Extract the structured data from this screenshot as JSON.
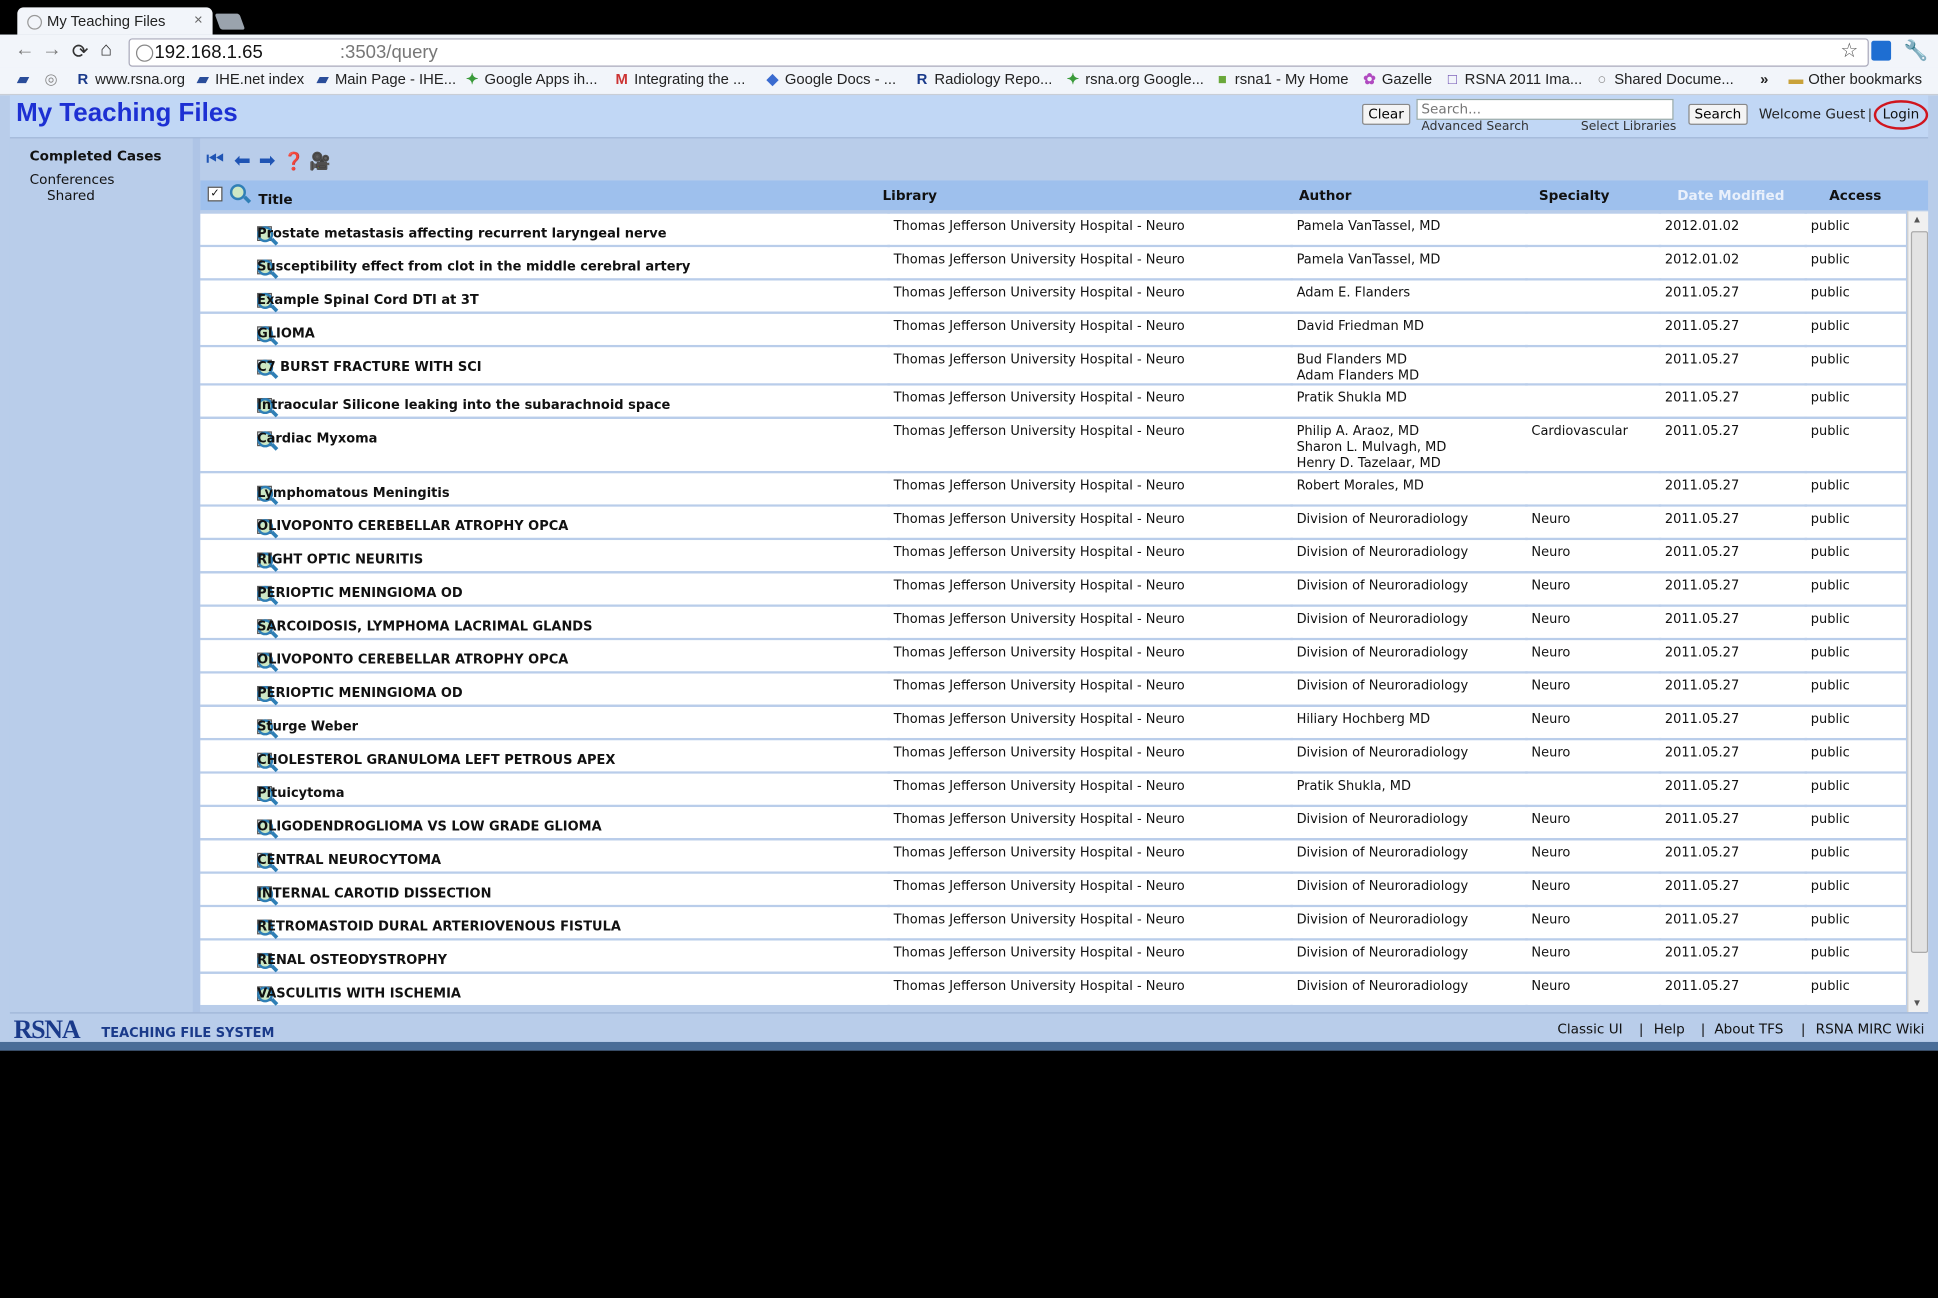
{
  "browser": {
    "tab_title": "My Teaching Files",
    "tab_close": "×",
    "url_host": "192.168.1.65",
    "url_path": ":3503/query",
    "bookmarks": [
      {
        "label": "www.rsna.org",
        "icon": "R"
      },
      {
        "label": "IHE.net index",
        "icon": "▰"
      },
      {
        "label": "Main Page - IHE...",
        "icon": "▰"
      },
      {
        "label": "Google Apps ih...",
        "icon": "✦"
      },
      {
        "label": "Integrating the ...",
        "icon": "M"
      },
      {
        "label": "Google Docs - ...",
        "icon": "◆"
      },
      {
        "label": "Radiology Repo...",
        "icon": "R"
      },
      {
        "label": "rsna.org Google...",
        "icon": "✦"
      },
      {
        "label": "rsna1 - My Home",
        "icon": "■"
      },
      {
        "label": "Gazelle",
        "icon": "✿"
      },
      {
        "label": "RSNA 2011 Ima...",
        "icon": "□"
      },
      {
        "label": "Shared Docume...",
        "icon": "○"
      }
    ],
    "more_bookmarks": "»",
    "other_bookmarks": "Other bookmarks"
  },
  "app": {
    "title": "My Teaching Files",
    "clear_label": "Clear",
    "search_placeholder": "Search...",
    "advanced_search": "Advanced Search",
    "select_libraries": "Select Libraries",
    "search_label": "Search",
    "welcome": "Welcome Guest",
    "separator": "|",
    "login_label": "Login"
  },
  "leftnav": {
    "heading": "Completed Cases",
    "conferences": "Conferences",
    "shared": "Shared"
  },
  "table": {
    "columns": [
      "Title",
      "Library",
      "Author",
      "Specialty",
      "Date Modified",
      "Access"
    ],
    "rows": [
      {
        "title": "Prostate metastasis affecting recurrent laryngeal nerve",
        "library": "Thomas Jefferson University Hospital - Neuro",
        "author": "Pamela VanTassel, MD",
        "specialty": "",
        "date": "2012.01.02",
        "access": "public"
      },
      {
        "title": "Susceptibility effect from clot in the middle cerebral artery",
        "library": "Thomas Jefferson University Hospital - Neuro",
        "author": "Pamela VanTassel, MD",
        "specialty": "",
        "date": "2012.01.02",
        "access": "public"
      },
      {
        "title": "Example Spinal Cord DTI at 3T",
        "library": "Thomas Jefferson University Hospital - Neuro",
        "author": "Adam E. Flanders",
        "specialty": "",
        "date": "2011.05.27",
        "access": "public"
      },
      {
        "title": "GLIOMA",
        "library": "Thomas Jefferson University Hospital - Neuro",
        "author": "David Friedman MD",
        "specialty": "",
        "date": "2011.05.27",
        "access": "public"
      },
      {
        "title": "C7 BURST FRACTURE WITH SCI",
        "library": "Thomas Jefferson University Hospital - Neuro",
        "author": "Bud Flanders MD\nAdam Flanders MD",
        "specialty": "",
        "date": "2011.05.27",
        "access": "public"
      },
      {
        "title": "Intraocular Silicone leaking into the subarachnoid space",
        "library": "Thomas Jefferson University Hospital - Neuro",
        "author": "Pratik Shukla MD",
        "specialty": "",
        "date": "2011.05.27",
        "access": "public"
      },
      {
        "title": "Cardiac Myxoma",
        "library": "Thomas Jefferson University Hospital - Neuro",
        "author": "Philip A. Araoz, MD\nSharon L. Mulvagh, MD\nHenry D. Tazelaar, MD",
        "specialty": "Cardiovascular",
        "date": "2011.05.27",
        "access": "public"
      },
      {
        "title": "Lymphomatous Meningitis",
        "library": "Thomas Jefferson University Hospital - Neuro",
        "author": "Robert Morales, MD",
        "specialty": "",
        "date": "2011.05.27",
        "access": "public"
      },
      {
        "title": "OLIVOPONTO CEREBELLAR ATROPHY OPCA",
        "library": "Thomas Jefferson University Hospital - Neuro",
        "author": "Division of Neuroradiology",
        "specialty": "Neuro",
        "date": "2011.05.27",
        "access": "public"
      },
      {
        "title": "RIGHT OPTIC NEURITIS",
        "library": "Thomas Jefferson University Hospital - Neuro",
        "author": "Division of Neuroradiology",
        "specialty": "Neuro",
        "date": "2011.05.27",
        "access": "public"
      },
      {
        "title": "PERIOPTIC MENINGIOMA OD",
        "library": "Thomas Jefferson University Hospital - Neuro",
        "author": "Division of Neuroradiology",
        "specialty": "Neuro",
        "date": "2011.05.27",
        "access": "public"
      },
      {
        "title": "SARCOIDOSIS, LYMPHOMA LACRIMAL GLANDS",
        "library": "Thomas Jefferson University Hospital - Neuro",
        "author": "Division of Neuroradiology",
        "specialty": "Neuro",
        "date": "2011.05.27",
        "access": "public"
      },
      {
        "title": "OLIVOPONTO CEREBELLAR ATROPHY OPCA",
        "library": "Thomas Jefferson University Hospital - Neuro",
        "author": "Division of Neuroradiology",
        "specialty": "Neuro",
        "date": "2011.05.27",
        "access": "public"
      },
      {
        "title": "PERIOPTIC MENINGIOMA OD",
        "library": "Thomas Jefferson University Hospital - Neuro",
        "author": "Division of Neuroradiology",
        "specialty": "Neuro",
        "date": "2011.05.27",
        "access": "public"
      },
      {
        "title": "Sturge Weber",
        "library": "Thomas Jefferson University Hospital - Neuro",
        "author": "Hiliary Hochberg MD",
        "specialty": "Neuro",
        "date": "2011.05.27",
        "access": "public"
      },
      {
        "title": "CHOLESTEROL GRANULOMA LEFT PETROUS APEX",
        "library": "Thomas Jefferson University Hospital - Neuro",
        "author": "Division of Neuroradiology",
        "specialty": "Neuro",
        "date": "2011.05.27",
        "access": "public"
      },
      {
        "title": "Pituicytoma",
        "library": "Thomas Jefferson University Hospital - Neuro",
        "author": "Pratik Shukla, MD",
        "specialty": "",
        "date": "2011.05.27",
        "access": "public"
      },
      {
        "title": "OLIGODENDROGLIOMA VS LOW GRADE GLIOMA",
        "library": "Thomas Jefferson University Hospital - Neuro",
        "author": "Division of Neuroradiology",
        "specialty": "Neuro",
        "date": "2011.05.27",
        "access": "public"
      },
      {
        "title": "CENTRAL NEUROCYTOMA",
        "library": "Thomas Jefferson University Hospital - Neuro",
        "author": "Division of Neuroradiology",
        "specialty": "Neuro",
        "date": "2011.05.27",
        "access": "public"
      },
      {
        "title": "INTERNAL CAROTID DISSECTION",
        "library": "Thomas Jefferson University Hospital - Neuro",
        "author": "Division of Neuroradiology",
        "specialty": "Neuro",
        "date": "2011.05.27",
        "access": "public"
      },
      {
        "title": "RETROMASTOID DURAL ARTERIOVENOUS FISTULA",
        "library": "Thomas Jefferson University Hospital - Neuro",
        "author": "Division of Neuroradiology",
        "specialty": "Neuro",
        "date": "2011.05.27",
        "access": "public"
      },
      {
        "title": "RENAL OSTEODYSTROPHY",
        "library": "Thomas Jefferson University Hospital - Neuro",
        "author": "Division of Neuroradiology",
        "specialty": "Neuro",
        "date": "2011.05.27",
        "access": "public"
      },
      {
        "title": "VASCULITIS WITH ISCHEMIA",
        "library": "Thomas Jefferson University Hospital - Neuro",
        "author": "Division of Neuroradiology",
        "specialty": "Neuro",
        "date": "2011.05.27",
        "access": "public"
      }
    ]
  },
  "footer": {
    "logo": "RSNA",
    "system": "TEACHING FILE SYSTEM",
    "links": [
      "Classic UI",
      "Help",
      "About TFS",
      "RSNA MIRC Wiki"
    ],
    "separator": "|"
  },
  "colors": {
    "title_blue": "#1d30d3",
    "header_band": "#c1d7f5",
    "table_header": "#9ec0ed",
    "login_circle": "#d0151e"
  }
}
